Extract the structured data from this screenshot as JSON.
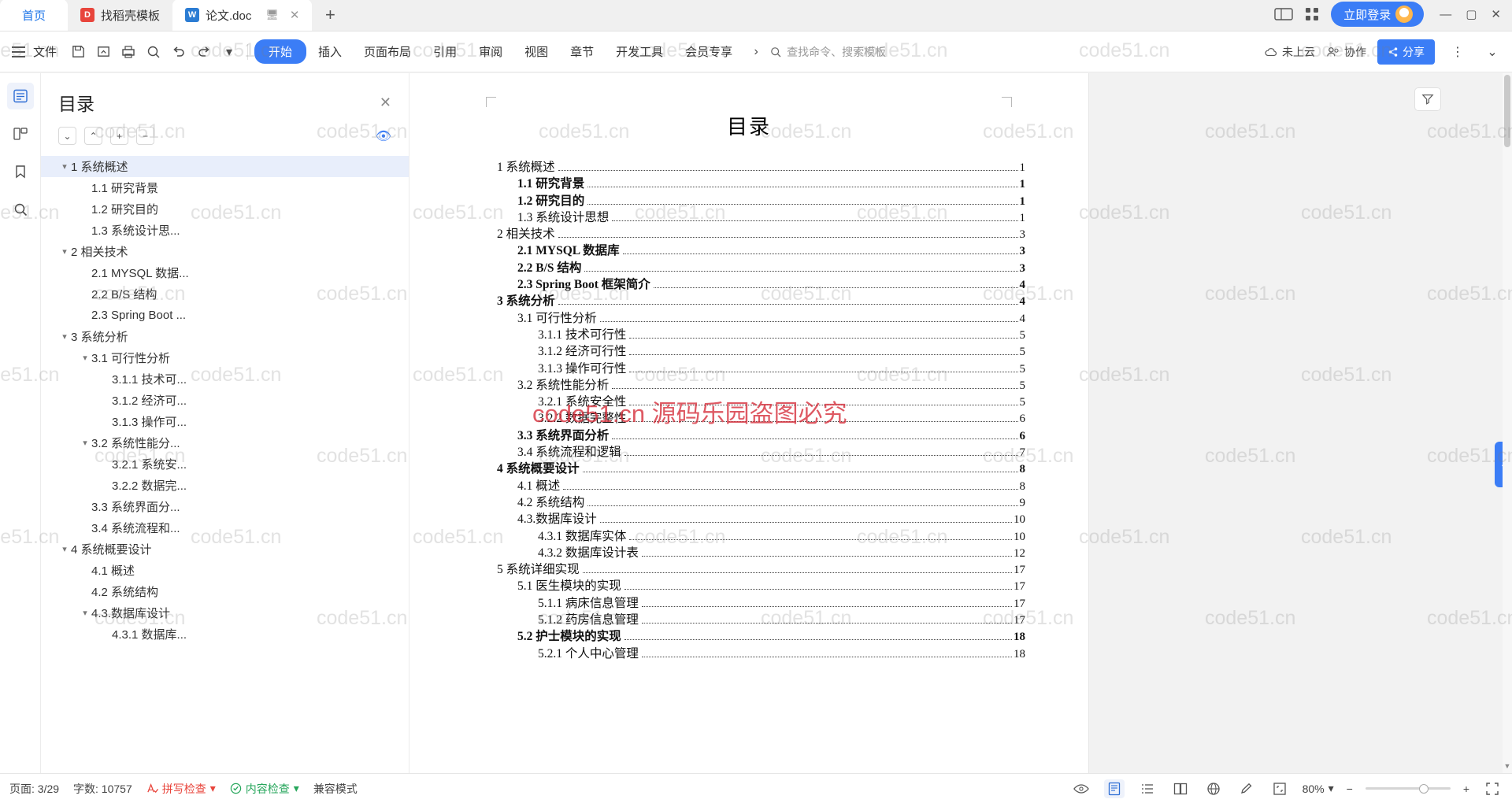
{
  "window": {
    "tabs": [
      {
        "label": "首页",
        "icon": "home",
        "type": "home"
      },
      {
        "label": "找稻壳模板",
        "icon": "docer-icon",
        "type": "docer"
      },
      {
        "label": "论文.doc",
        "icon": "word-doc-icon",
        "type": "doc",
        "active": true
      }
    ],
    "new_tab": "+",
    "login_label": "立即登录",
    "win_min": "—",
    "win_max": "▢",
    "win_close": "✕"
  },
  "ribbon": {
    "file_label": "文件",
    "menus": [
      "开始",
      "插入",
      "页面布局",
      "引用",
      "审阅",
      "视图",
      "章节",
      "开发工具",
      "会员专享"
    ],
    "active_menu": "开始",
    "search_placeholder": "查找命令、搜索模板",
    "cloud_label": "未上云",
    "collab_label": "协作",
    "share_label": "分享"
  },
  "outline": {
    "title": "目录",
    "nodes": [
      {
        "label": "1 系统概述",
        "level": 1,
        "caret": "▾",
        "selected": true
      },
      {
        "label": "1.1 研究背景",
        "level": 2,
        "caret": ""
      },
      {
        "label": "1.2 研究目的",
        "level": 2,
        "caret": ""
      },
      {
        "label": "1.3 系统设计思...",
        "level": 2,
        "caret": ""
      },
      {
        "label": "2 相关技术",
        "level": 1,
        "caret": "▾"
      },
      {
        "label": "2.1 MYSQL 数据...",
        "level": 2,
        "caret": ""
      },
      {
        "label": "2.2 B/S 结构",
        "level": 2,
        "caret": ""
      },
      {
        "label": "2.3 Spring Boot ...",
        "level": 2,
        "caret": ""
      },
      {
        "label": "3 系统分析",
        "level": 1,
        "caret": "▾"
      },
      {
        "label": "3.1 可行性分析",
        "level": 2,
        "caret": "▾"
      },
      {
        "label": "3.1.1 技术可...",
        "level": 3,
        "caret": ""
      },
      {
        "label": "3.1.2 经济可...",
        "level": 3,
        "caret": ""
      },
      {
        "label": "3.1.3 操作可...",
        "level": 3,
        "caret": ""
      },
      {
        "label": "3.2 系统性能分...",
        "level": 2,
        "caret": "▾"
      },
      {
        "label": "3.2.1 系统安...",
        "level": 3,
        "caret": ""
      },
      {
        "label": "3.2.2 数据完...",
        "level": 3,
        "caret": ""
      },
      {
        "label": "3.3 系统界面分...",
        "level": 2,
        "caret": ""
      },
      {
        "label": "3.4 系统流程和...",
        "level": 2,
        "caret": ""
      },
      {
        "label": "4 系统概要设计",
        "level": 1,
        "caret": "▾"
      },
      {
        "label": "4.1 概述",
        "level": 2,
        "caret": ""
      },
      {
        "label": "4.2 系统结构",
        "level": 2,
        "caret": ""
      },
      {
        "label": "4.3.数据库设计",
        "level": 2,
        "caret": "▾"
      },
      {
        "label": "4.3.1 数据库...",
        "level": 3,
        "caret": ""
      }
    ]
  },
  "document": {
    "title": "目录",
    "toc": [
      {
        "label": "1 系统概述",
        "page": "1",
        "indent": 1,
        "bold": false
      },
      {
        "label": "1.1  研究背景",
        "page": "1",
        "indent": 2,
        "bold": true
      },
      {
        "label": "1.2 研究目的",
        "page": "1",
        "indent": 2,
        "bold": true
      },
      {
        "label": "1.3 系统设计思想",
        "page": "1",
        "indent": 2,
        "bold": false
      },
      {
        "label": "2 相关技术",
        "page": "3",
        "indent": 1,
        "bold": false
      },
      {
        "label": "2.1 MYSQL 数据库",
        "page": "3",
        "indent": 2,
        "bold": true
      },
      {
        "label": "2.2 B/S 结构",
        "page": "3",
        "indent": 2,
        "bold": true
      },
      {
        "label": "2.3 Spring Boot 框架简介",
        "page": "4",
        "indent": 2,
        "bold": true
      },
      {
        "label": "3 系统分析",
        "page": "4",
        "indent": 1,
        "bold": true
      },
      {
        "label": "3.1 可行性分析",
        "page": "4",
        "indent": 2,
        "bold": false
      },
      {
        "label": "3.1.1 技术可行性",
        "page": "5",
        "indent": 3,
        "bold": false
      },
      {
        "label": "3.1.2 经济可行性",
        "page": "5",
        "indent": 3,
        "bold": false
      },
      {
        "label": "3.1.3 操作可行性",
        "page": "5",
        "indent": 3,
        "bold": false
      },
      {
        "label": "3.2 系统性能分析",
        "page": "5",
        "indent": 2,
        "bold": false
      },
      {
        "label": "3.2.1 系统安全性",
        "page": "5",
        "indent": 3,
        "bold": false
      },
      {
        "label": "3.2.2 数据完整性",
        "page": "6",
        "indent": 3,
        "bold": false
      },
      {
        "label": "3.3 系统界面分析",
        "page": "6",
        "indent": 2,
        "bold": true
      },
      {
        "label": "3.4 系统流程和逻辑",
        "page": "7",
        "indent": 2,
        "bold": false
      },
      {
        "label": "4 系统概要设计",
        "page": "8",
        "indent": 1,
        "bold": true
      },
      {
        "label": "4.1 概述",
        "page": "8",
        "indent": 2,
        "bold": false
      },
      {
        "label": "4.2 系统结构",
        "page": "9",
        "indent": 2,
        "bold": false
      },
      {
        "label": "4.3.数据库设计",
        "page": "10",
        "indent": 2,
        "bold": false
      },
      {
        "label": "4.3.1 数据库实体",
        "page": "10",
        "indent": 3,
        "bold": false
      },
      {
        "label": "4.3.2 数据库设计表",
        "page": "12",
        "indent": 3,
        "bold": false
      },
      {
        "label": "5 系统详细实现",
        "page": "17",
        "indent": 1,
        "bold": false
      },
      {
        "label": "5.1 医生模块的实现",
        "page": "17",
        "indent": 2,
        "bold": false
      },
      {
        "label": "5.1.1 病床信息管理",
        "page": "17",
        "indent": 3,
        "bold": false
      },
      {
        "label": "5.1.2 药房信息管理",
        "page": "17",
        "indent": 3,
        "bold": false
      },
      {
        "label": "5.2 护士模块的实现",
        "page": "18",
        "indent": 2,
        "bold": true
      },
      {
        "label": "5.2.1 个人中心管理",
        "page": "18",
        "indent": 3,
        "bold": false
      }
    ]
  },
  "statusbar": {
    "page_label": "页面: 3/29",
    "word_count": "字数: 10757",
    "spellcheck": "拼写检查",
    "content_check": "内容检查",
    "compat_mode": "兼容模式",
    "zoom_label": "80%",
    "zoom_out": "−",
    "zoom_in": "+"
  },
  "watermark": {
    "tile_text": "code51.cn",
    "center_text": "code51.cn 源码乐园盗图必究"
  }
}
